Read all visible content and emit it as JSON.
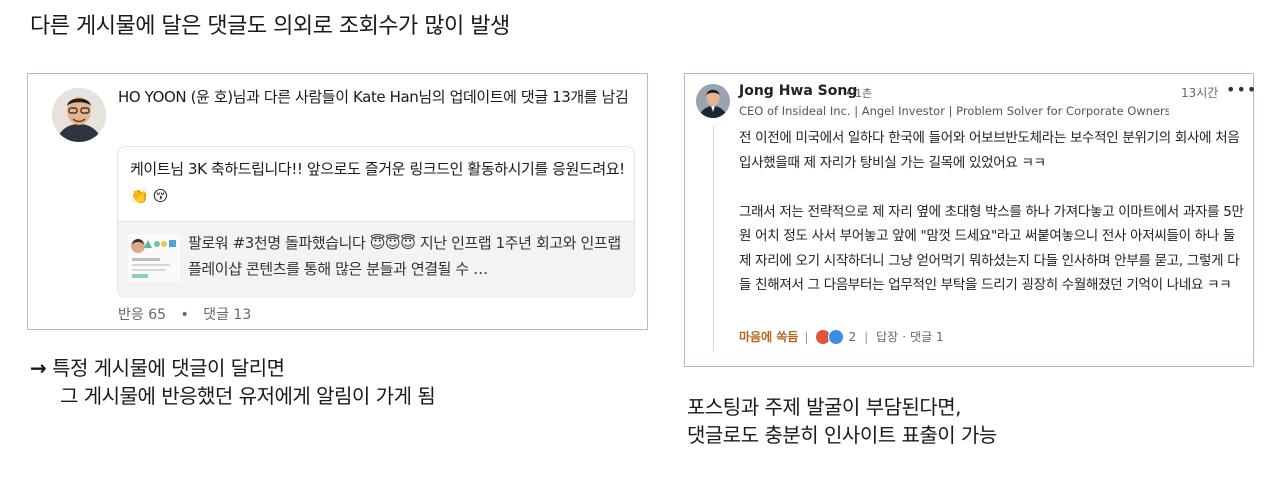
{
  "slide": {
    "title": "다른 게시물에 달은 댓글도 의외로 조회수가 많이 발생",
    "left_caption": {
      "arrow": "→",
      "line1": "특정 게시물에 댓글이 달리면",
      "line2": "그 게시물에 반응했던 유저에게 알림이 가게 됨"
    },
    "right_caption": {
      "line1": "포스팅과 주제 발굴이 부담된다면,",
      "line2": "댓글로도 충분히 인사이트 표출이 가능"
    }
  },
  "left_card": {
    "notification_text": "HO YOON (윤 호)님과 다른 사람들이 Kate Han님의 업데이트에 댓글 13개를 남김",
    "comment_text": "케이트님 3K 축하드립니다!! 앞으로도 즐거운 링크드인 활동하시기를 응원드려요! 👏 😚",
    "shared_post_text": "팔로워 #3천명 돌파했습니다 😇😇😇 지난 인프랩 1주년 회고와 인프랩 플레이샵 콘텐츠를 통해 많은 분들과 연결될 수 …",
    "reactions": "반응 65",
    "dot": "•",
    "comments": "댓글 13"
  },
  "right_card": {
    "author_name": "Jong Hwa Song",
    "degree": "• 1촌",
    "time": "13시간",
    "more": "•••",
    "headline": "CEO of Insideal Inc. | Angel Investor | Problem Solver for Corporate Owners | …",
    "paragraph1": "전 이전에 미국에서 일하다 한국에 들어와 어보브반도체라는 보수적인 분위기의 회사에 처음 입사했을때 제 자리가 탕비실 가는 길목에 있었어요 ㅋㅋ",
    "paragraph2": "그래서 저는 전략적으로 제 자리 옆에 초대형 박스를 하나 가져다놓고 이마트에서 과자를 5만원 어치 정도 사서 부어놓고 앞에 \"맘껏 드세요\"라고 써붙여놓으니 전사 아저씨들이 하나 둘 제 자리에 오기 시작하더니 그냥 얻어먹기 뭐하셨는지 다들 인사하며 안부를 묻고, 그렇게 다들 친해져서 그 다음부터는 업무적인 부탁을 드리기 굉장히 수월해졌던 기억이 나네요 ㅋㅋ",
    "reaction_label": "마음에 쏙듬",
    "reaction_count": "2",
    "reply_label": "답장",
    "reply_sep": "·",
    "reply_count": "댓글 1",
    "action_sep": "|",
    "reaction_colors": [
      "#e0533c",
      "#5b8fd6",
      "#378fe9"
    ]
  }
}
